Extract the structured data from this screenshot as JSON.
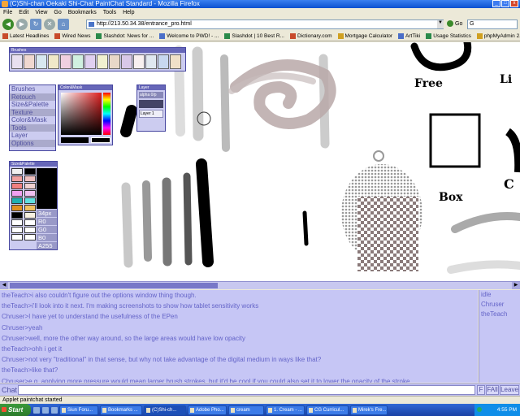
{
  "window": {
    "title": "(C)Shi-chan Oekaki Shi-Chat PaintChat Standard - Mozilla Firefox",
    "min": "_",
    "max": "□",
    "close": "x"
  },
  "menu": [
    "File",
    "Edit",
    "View",
    "Go",
    "Bookmarks",
    "Tools",
    "Help"
  ],
  "nav": {
    "url": "http://213.50.34.38/entrance_pro.html",
    "go_label": "Go",
    "search_value": "G"
  },
  "bookmarks": [
    "Latest Headlines",
    "Wired News",
    "Slashdot: News for ...",
    "Welcome to PWD! - ...",
    "Slashdot | 10 Best R...",
    "Dictionary.com",
    "Mortgage Calculator",
    "ArtTiki",
    "Usage Statistics",
    "phpMyAdmin 2.4.0"
  ],
  "panels": {
    "brushes_title": "Brushes",
    "menu_items": [
      "Brushes",
      "Retouch",
      "Size&Palette",
      "Texture",
      "Color&Mask",
      "Tools",
      "Layer",
      "Options"
    ],
    "colormask_title": "Color&Mask",
    "layer_title": "Layer",
    "layer_items": [
      "alpha 0/p",
      "",
      "Layer 1"
    ],
    "sizepalette_title": "Size&Palette",
    "size_values": [
      "34px",
      "R0",
      "G0",
      "B0",
      "A255"
    ]
  },
  "canvas_text": {
    "free": "Free",
    "box": "Box",
    "l": "Li",
    "c": "C"
  },
  "chat": {
    "lines": [
      "theTeach>i also couldn't figure out the options window thing though.",
      "theTeach>i'll look into it next. I'm making screenshots to show how tablet sensitivity works",
      "Chruser>I have yet to understand the usefulness of the EPen",
      "Chruser>yeah",
      "Chruser>well, more the other way around, so the large areas would have low opacity",
      "theTeach>ohh i get it",
      "Chruser>not very \"traditional\" in that sense, but why not take advantage of the digital medium in ways like that?",
      "theTeach>like that?",
      "Chruser>e.g. applying more pressure would mean larger brush strokes, but it'd be cool if you could also set it to lower the opacity of the stroke"
    ],
    "users": [
      "idle",
      "Chruser",
      "theTeach"
    ],
    "input_label": "Chat",
    "btn_f": "F",
    "btn_fall": "FAll",
    "btn_leave": "Leave"
  },
  "status": "Applet paintchat started",
  "taskbar": {
    "start": "Start",
    "tasks": [
      "Siun Foru...",
      "Bookmarks ...",
      "(C)Shi-ch...",
      "Adobe Pho...",
      "cream",
      "1. Cream - ...",
      "CG Curricul...",
      "Mirek's Fre..."
    ],
    "clock": "4:55 PM"
  },
  "colors": {
    "accent": "#6464c8",
    "chat_bg": "#c6c6f5",
    "panel_bg": "#ccccf0"
  }
}
